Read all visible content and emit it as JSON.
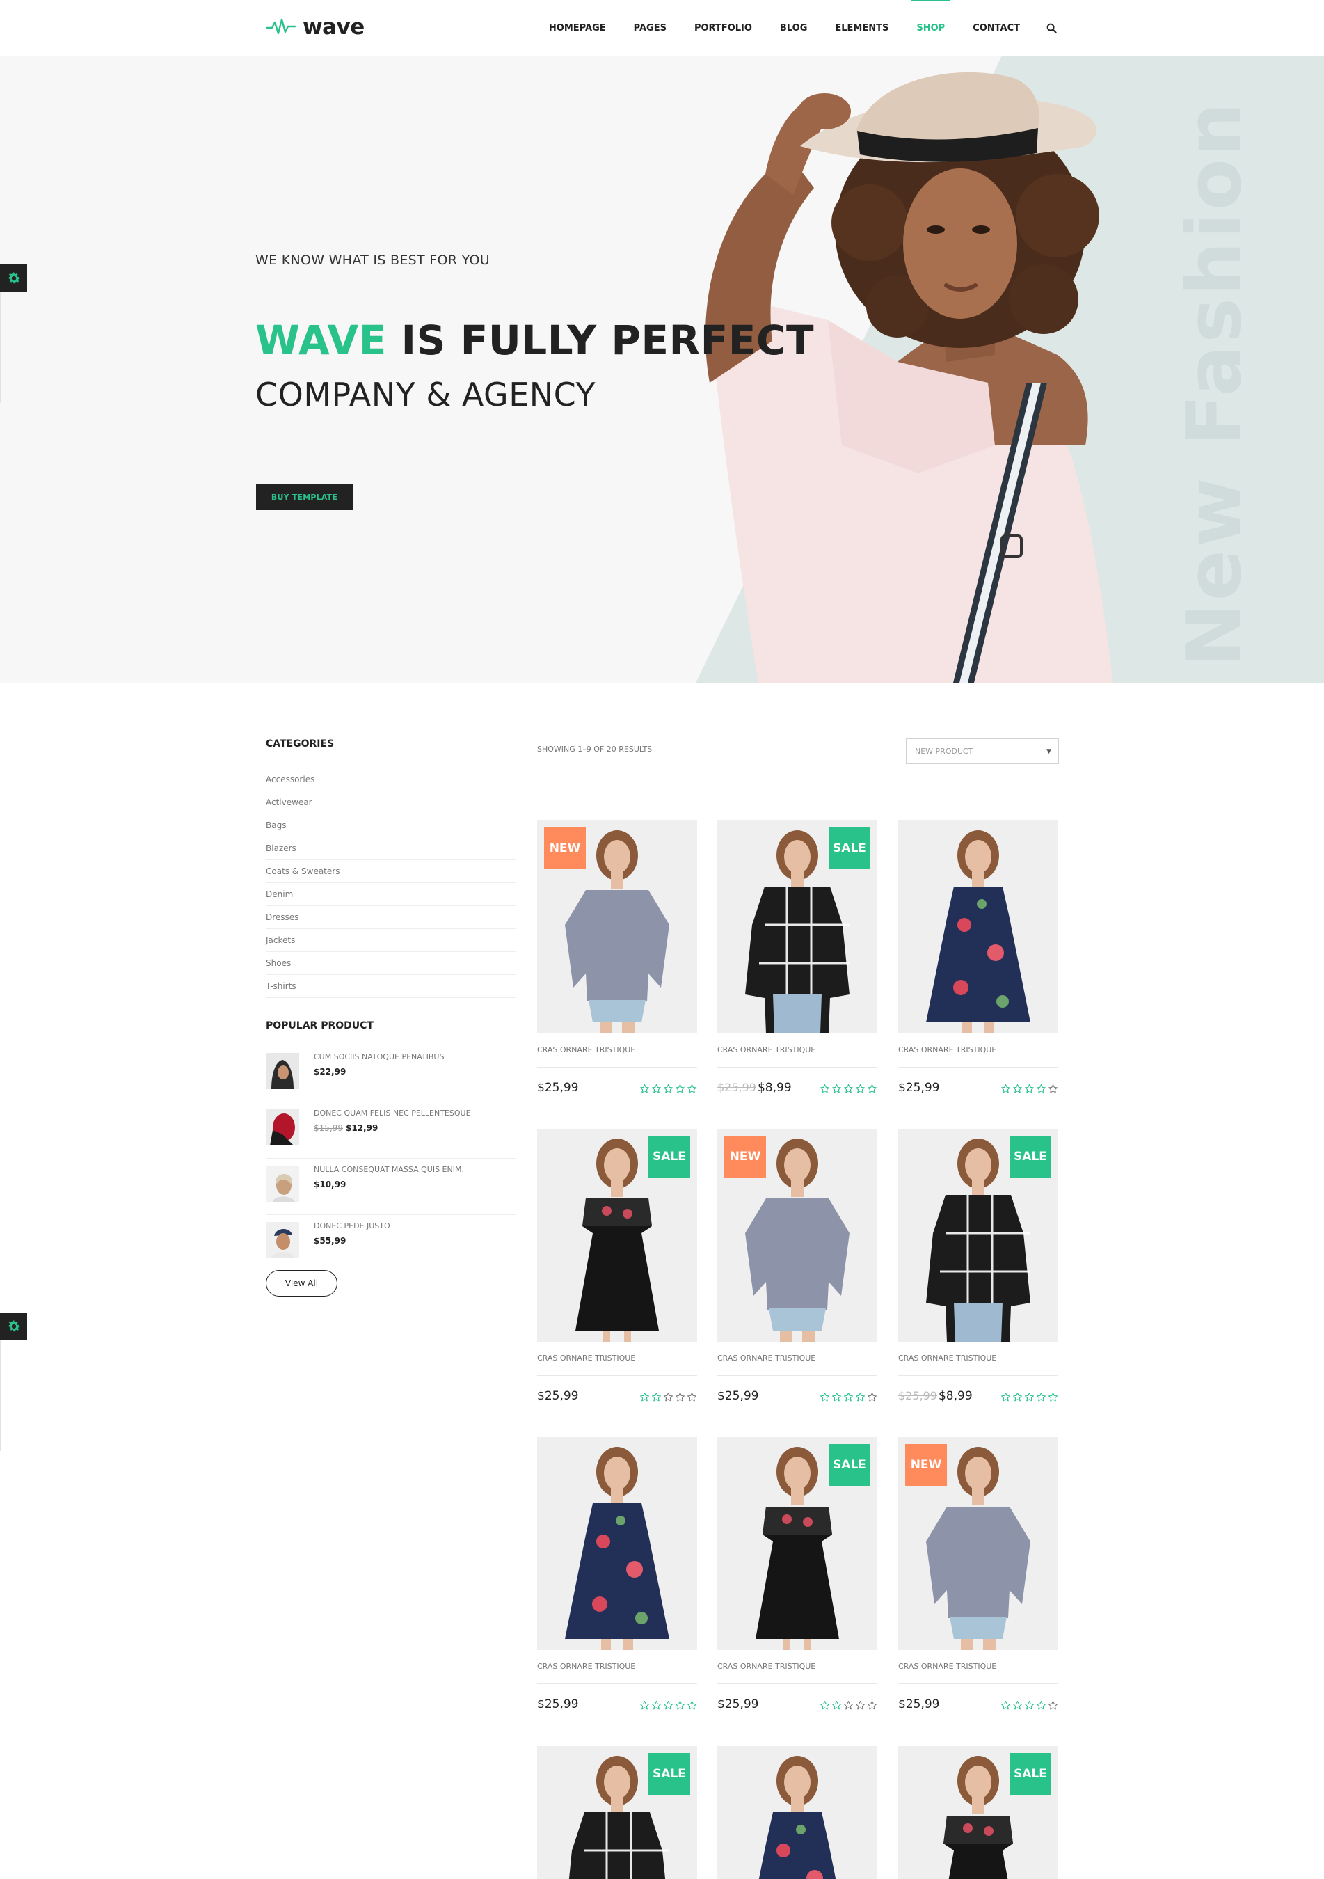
{
  "brand": {
    "name": "wave",
    "accent": "#29c28b",
    "badge_new": "#ff8a5b",
    "dark": "#222222"
  },
  "nav": {
    "items": [
      "HOMEPAGE",
      "PAGES",
      "PORTFOLIO",
      "BLOG",
      "ELEMENTS",
      "SHOP",
      "CONTACT"
    ],
    "active": "SHOP",
    "search_icon": "search-icon"
  },
  "hero": {
    "kicker": "WE KNOW WHAT IS BEST FOR YOU",
    "title_accent": "WAVE",
    "title_rest": " IS FULLY PERFECT",
    "subtitle": "COMPANY & AGENCY",
    "button": "BUY TEMPLATE",
    "watermark": "New Fashion"
  },
  "sidebar": {
    "categories_title": "CATEGORIES",
    "categories": [
      "Accessories",
      "Activewear",
      "Bags",
      "Blazers",
      "Coats & Sweaters",
      "Denim",
      "Dresses",
      "Jackets",
      "Shoes",
      "T-shirts"
    ],
    "popular_title": "POPULAR PRODUCT",
    "popular": [
      {
        "name": "CUM SOCIIS NATOQUE PENATIBUS",
        "old_price": "",
        "price": "$22,99"
      },
      {
        "name": "DONEC QUAM FELIS NEC PELLENTESQUE",
        "old_price": "$15,99",
        "price": "$12,99"
      },
      {
        "name": "NULLA CONSEQUAT MASSA QUIS ENIM.",
        "old_price": "",
        "price": "$10,99"
      },
      {
        "name": "DONEC PEDE JUSTO",
        "old_price": "",
        "price": "$55,99"
      }
    ],
    "view_all": "View All"
  },
  "shop": {
    "results_text": "SHOWING 1–9 OF 20 RESULTS",
    "sort_selected": "NEW PRODUCT",
    "products": [
      {
        "badge": "NEW",
        "name": "CRAS ORNARE TRISTIQUE",
        "old_price": "",
        "price": "$25,99",
        "rating": 5,
        "image": "gray-blouse"
      },
      {
        "badge": "SALE",
        "name": "CRAS ORNARE TRISTIQUE",
        "old_price": "$25,99",
        "price": "$8,99",
        "rating": 5,
        "image": "check-shirt"
      },
      {
        "badge": "",
        "name": "CRAS ORNARE TRISTIQUE",
        "old_price": "",
        "price": "$25,99",
        "rating": 4,
        "image": "floral-dress"
      },
      {
        "badge": "SALE",
        "name": "CRAS ORNARE TRISTIQUE",
        "old_price": "",
        "price": "$25,99",
        "rating": 2,
        "image": "black-dress"
      },
      {
        "badge": "NEW",
        "name": "CRAS ORNARE TRISTIQUE",
        "old_price": "",
        "price": "$25,99",
        "rating": 4,
        "image": "gray-blouse"
      },
      {
        "badge": "SALE",
        "name": "CRAS ORNARE TRISTIQUE",
        "old_price": "$25,99",
        "price": "$8,99",
        "rating": 5,
        "image": "check-shirt"
      },
      {
        "badge": "",
        "name": "CRAS ORNARE TRISTIQUE",
        "old_price": "",
        "price": "$25,99",
        "rating": 5,
        "image": "floral-dress"
      },
      {
        "badge": "SALE",
        "name": "CRAS ORNARE TRISTIQUE",
        "old_price": "",
        "price": "$25,99",
        "rating": 2,
        "image": "black-dress"
      },
      {
        "badge": "NEW",
        "name": "CRAS ORNARE TRISTIQUE",
        "old_price": "",
        "price": "$25,99",
        "rating": 4,
        "image": "gray-blouse"
      },
      {
        "badge": "SALE",
        "name": "",
        "old_price": "",
        "price": "",
        "rating": 0,
        "image": "check-shirt"
      },
      {
        "badge": "",
        "name": "",
        "old_price": "",
        "price": "",
        "rating": 0,
        "image": "floral-dress"
      },
      {
        "badge": "SALE",
        "name": "",
        "old_price": "",
        "price": "",
        "rating": 0,
        "image": "black-dress"
      }
    ]
  }
}
